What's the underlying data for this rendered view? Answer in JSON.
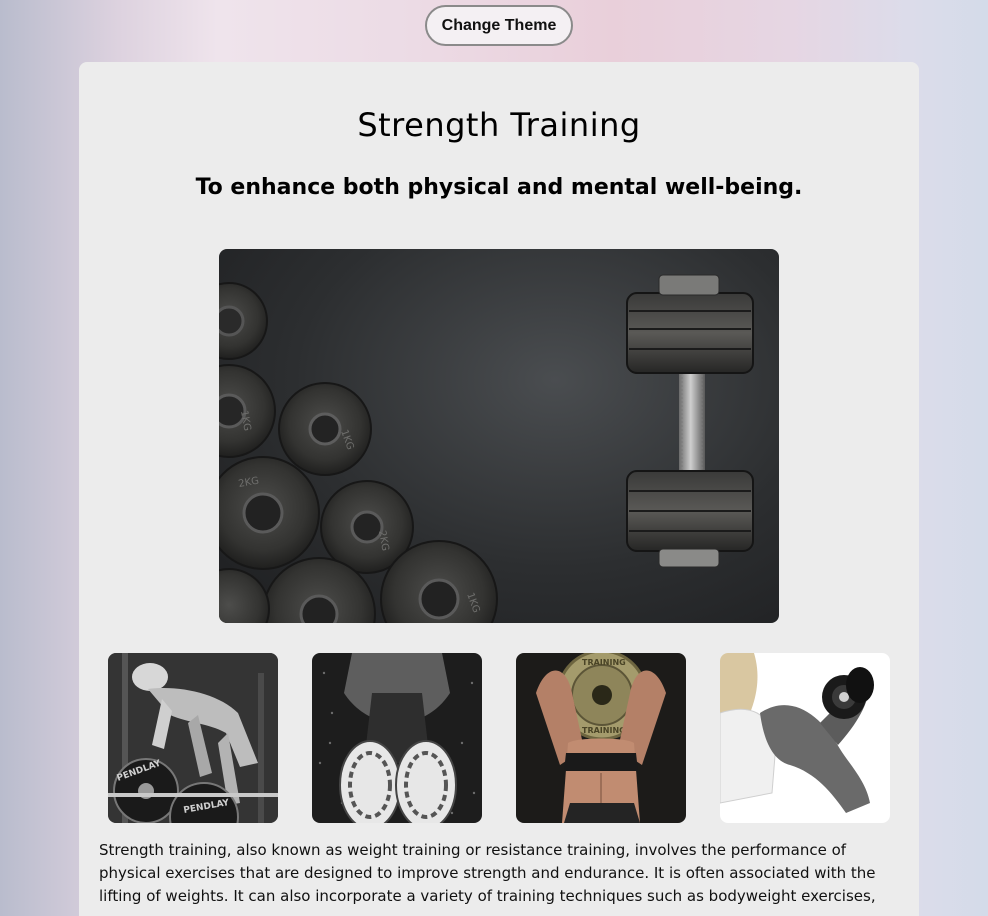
{
  "header": {
    "theme_button_label": "Change Theme"
  },
  "main": {
    "title": "Strength Training",
    "subtitle": "To enhance both physical and mental well-being.",
    "paragraph": "Strength training, also known as weight training or resistance training, involves the performance of physical exercises that are designed to improve strength and endurance. It is often associated with the lifting of weights. It can also incorporate a variety of training techniques such as bodyweight exercises,"
  },
  "hero_image": {
    "plate_markings": [
      "1KG",
      "1KG",
      "2KG",
      "2KG",
      "1KG"
    ]
  },
  "thumbnails": {
    "barbell_plate_text": [
      "PENDLAY",
      "PENDLAY"
    ],
    "weight_plate_text": [
      "TRAINING",
      "TRAINING"
    ]
  }
}
